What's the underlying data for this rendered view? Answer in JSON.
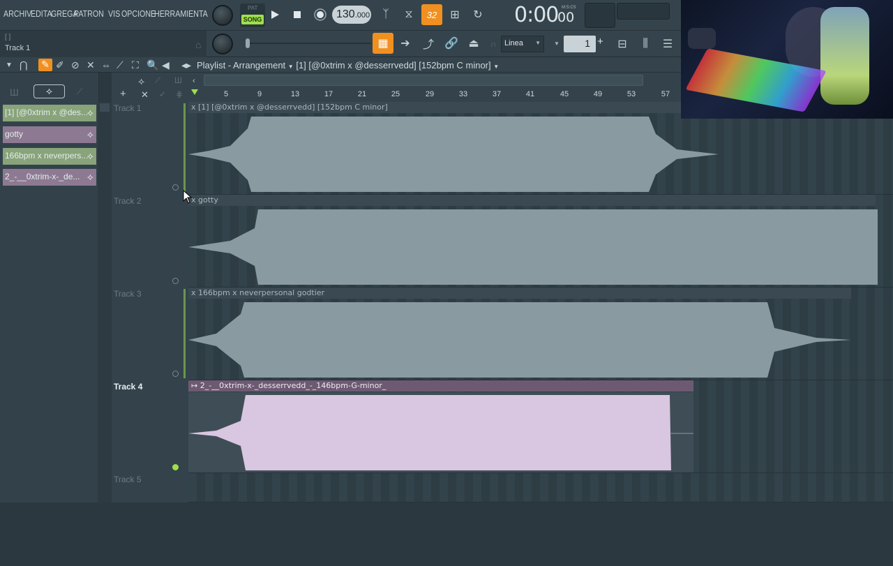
{
  "menu": [
    "ARCHIV",
    "EDITA",
    "GREGA",
    "PATRON",
    "VIS",
    "OPCIONE",
    "HERRAMIENTA"
  ],
  "hint_bar": {
    "line1": "[ ]",
    "line2": "Track 1"
  },
  "transport": {
    "pat_label": "PAT",
    "song_label": "SONG",
    "tempo": "130",
    "tempo_decimal": ".000",
    "time": "0:00",
    "time_sub": "00",
    "time_format": "M:S:CS",
    "step_display": "32"
  },
  "snap": {
    "value": "Linea"
  },
  "pattern": {
    "number": "1"
  },
  "playlist": {
    "title": "Playlist - Arrangement",
    "clip_ref": "[1] [@0xtrim x @desserrvedd] [152bpm C minor]"
  },
  "ruler": {
    "ticks": [
      "5",
      "9",
      "13",
      "17",
      "21",
      "25",
      "29",
      "33",
      "37",
      "41",
      "45",
      "49",
      "53",
      "57"
    ]
  },
  "picker": {
    "clips": [
      {
        "label": "[1] [@0xtrim x @des..."
      },
      {
        "label": "gotty"
      },
      {
        "label": "166bpm x neverpers..."
      },
      {
        "label": "2_-__0xtrim-x-_de..."
      }
    ]
  },
  "tracks": [
    {
      "label": "Track 1",
      "clip": "x [1] [@0xtrim x @desserrvedd] [152bpm C minor]"
    },
    {
      "label": "Track 2",
      "clip": "x gotty"
    },
    {
      "label": "Track 3",
      "clip": "x 166bpm x neverpersonal godtier"
    },
    {
      "label": "Track 4",
      "clip": "↦ 2_-__0xtrim-x-_desserrvedd_-_146bpm-G-minor_"
    },
    {
      "label": "Track 5",
      "clip": ""
    }
  ],
  "colors": {
    "accent": "#f09020",
    "song_green": "#9ee04a",
    "selected_clip": "#d9c6e0",
    "wave_gray": "#8a9aa1"
  }
}
